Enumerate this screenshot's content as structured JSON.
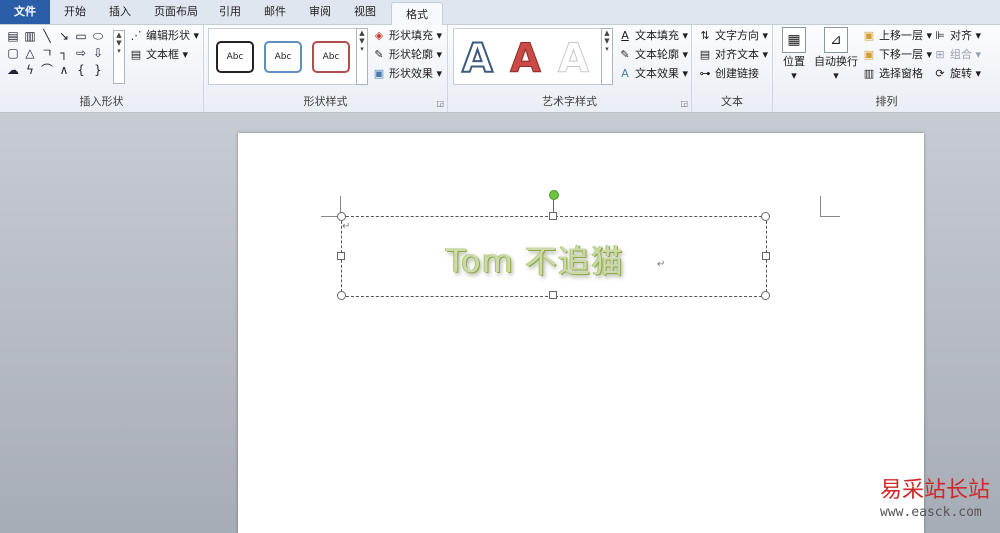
{
  "tabs": {
    "file": "文件",
    "home": "开始",
    "insert": "插入",
    "layout": "页面布局",
    "references": "引用",
    "mailings": "邮件",
    "review": "审阅",
    "view": "视图",
    "format": "格式"
  },
  "groups": {
    "insert_shapes": {
      "label": "插入形状",
      "edit_shape": "编辑形状",
      "text_box": "文本框"
    },
    "shape_styles": {
      "label": "形状样式",
      "thumb_text": "Abc",
      "shape_fill": "形状填充",
      "shape_outline": "形状轮廓",
      "shape_effects": "形状效果"
    },
    "wordart_styles": {
      "label": "艺术字样式",
      "sample": "A",
      "text_fill": "文本填充",
      "text_outline": "文本轮廓",
      "text_effects": "文本效果"
    },
    "text": {
      "label": "文本",
      "text_direction": "文字方向",
      "align_text": "对齐文本",
      "create_link": "创建链接"
    },
    "arrange": {
      "label": "排列",
      "position": "位置",
      "wrap_text": "自动换行",
      "bring_forward": "上移一层",
      "send_backward": "下移一层",
      "selection_pane": "选择窗格",
      "align": "对齐",
      "group": "组合",
      "rotate": "旋转"
    }
  },
  "document": {
    "wordart_text": "Tom 不追猫",
    "paragraph_mark": "↵"
  },
  "watermark": {
    "brand": "易采站长站",
    "url": "www.easck.com"
  },
  "colors": {
    "file_tab": "#2a5ea9",
    "wordart_fill": "#ccd9a8",
    "wordart_outline": "#8ea64a",
    "watermark": "#d0282a"
  }
}
